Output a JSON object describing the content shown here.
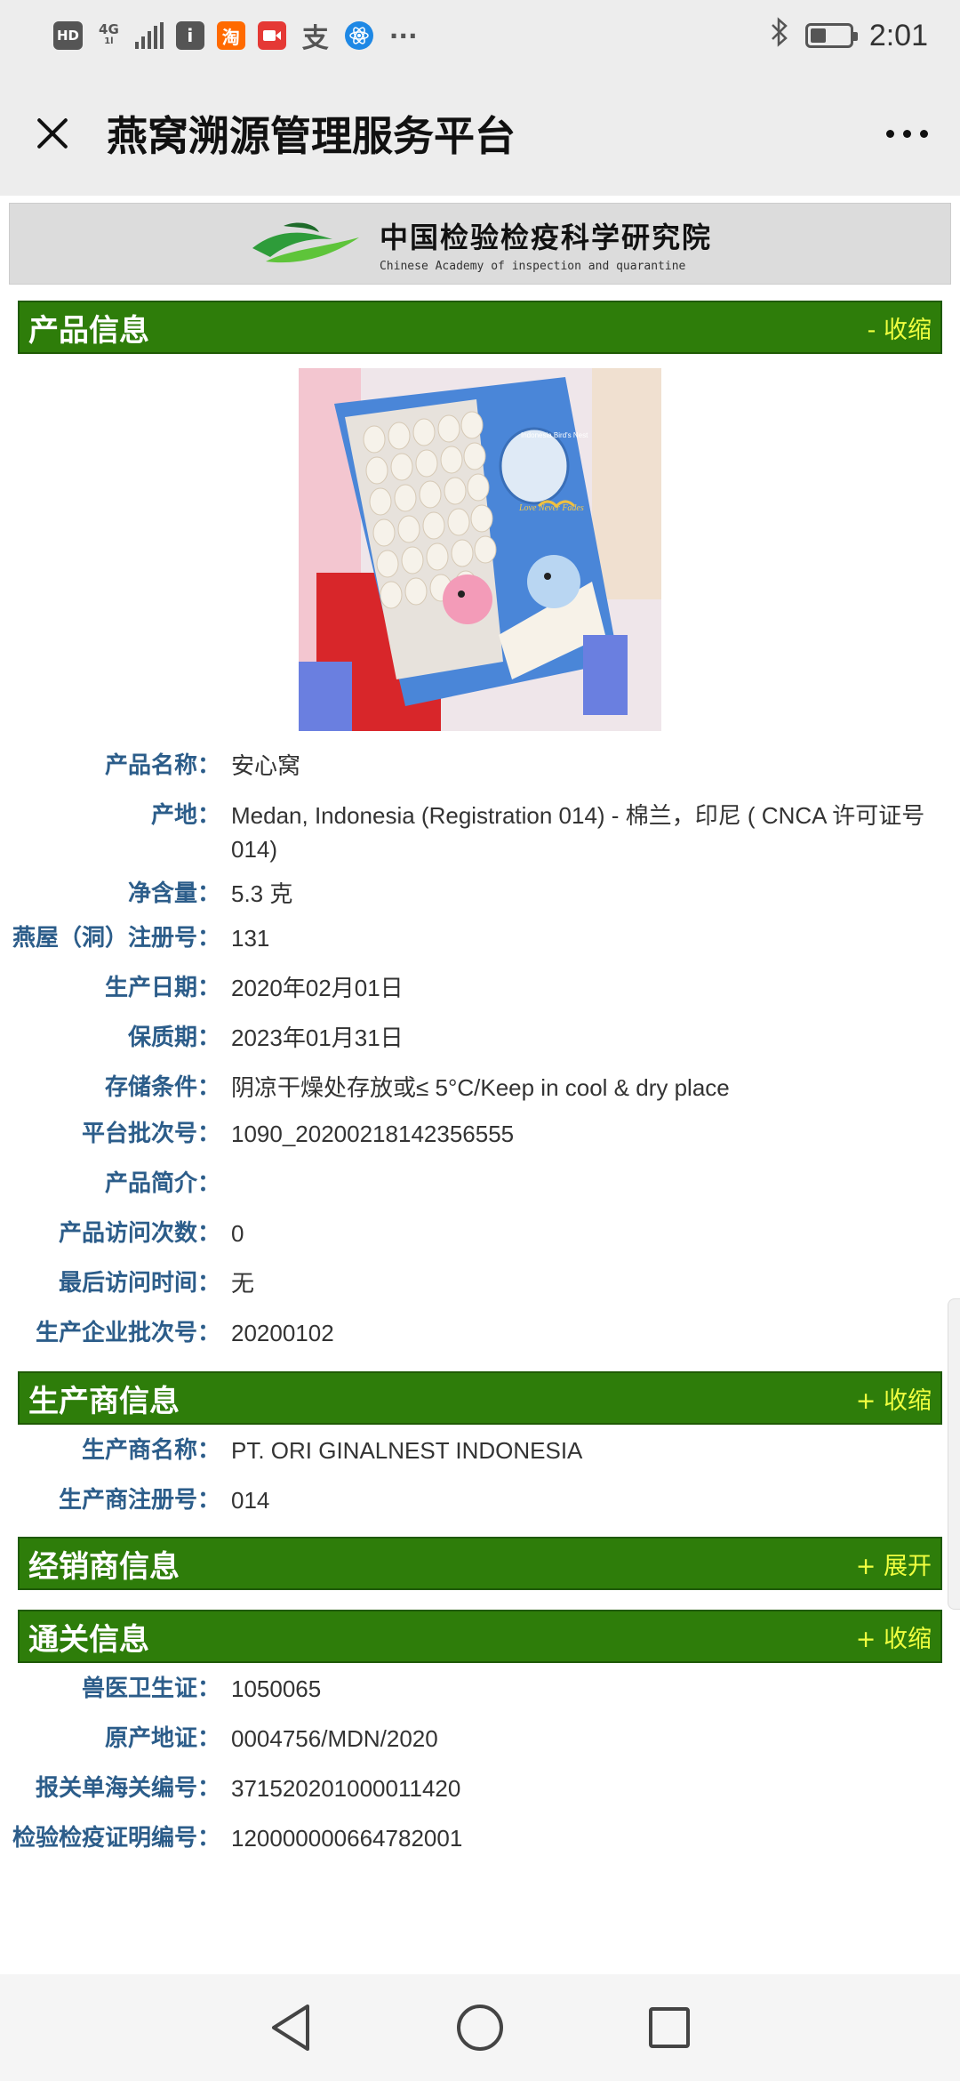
{
  "status_bar": {
    "hd": "HD",
    "network": "4G",
    "network_sub": "1l",
    "app_icons": [
      "info-icon",
      "taobao-icon",
      "video-icon",
      "alipay-icon",
      "react-icon"
    ],
    "taobao_glyph": "淘",
    "alipay_glyph": "支",
    "more": "···",
    "time": "2:01",
    "battery_level": 0.4
  },
  "header": {
    "title": "燕窝溯源管理服务平台"
  },
  "banner": {
    "name_cn": "中国检验检疫科学研究院",
    "name_en": "Chinese Academy of inspection and quarantine"
  },
  "sections": {
    "product": {
      "title": "产品信息",
      "toggle": "- 收缩",
      "fields": [
        {
          "label": "产品名称：",
          "value": "安心窝"
        },
        {
          "label": "产地：",
          "value": "Medan, Indonesia (Registration 014) - 棉兰，印尼 ( CNCA 许可证号 014)"
        },
        {
          "label": "净含量：",
          "value": "5.3 克"
        },
        {
          "label": "燕屋（洞）注册号：",
          "value": "131"
        },
        {
          "label": "生产日期：",
          "value": "2020年02月01日"
        },
        {
          "label": "保质期：",
          "value": "2023年01月31日"
        },
        {
          "label": "存储条件：",
          "value": "阴凉干燥处存放或≤ 5°C/Keep in cool & dry place"
        },
        {
          "label": "平台批次号：",
          "value": "1090_20200218142356555"
        },
        {
          "label": "产品简介：",
          "value": ""
        },
        {
          "label": "产品访问次数：",
          "value": "0"
        },
        {
          "label": "最后访问时间：",
          "value": "无"
        },
        {
          "label": "生产企业批次号：",
          "value": "20200102"
        }
      ]
    },
    "manufacturer": {
      "title": "生产商信息",
      "toggle": "+ 收缩",
      "fields": [
        {
          "label": "生产商名称：",
          "value": "PT. ORI GINALNEST INDONESIA"
        },
        {
          "label": "生产商注册号：",
          "value": "014"
        }
      ]
    },
    "distributor": {
      "title": "经销商信息",
      "toggle": "+ 展开"
    },
    "customs": {
      "title": "通关信息",
      "toggle": "+ 收缩",
      "fields": [
        {
          "label": "兽医卫生证：",
          "value": "1050065"
        },
        {
          "label": "原产地证：",
          "value": "0004756/MDN/2020"
        },
        {
          "label": "报关单海关编号：",
          "value": "371520201000011420"
        },
        {
          "label": "检验检疫证明编号：",
          "value": "120000000664782001"
        }
      ]
    }
  },
  "product_image": {
    "box_label": "Indonesia Bird's Nest",
    "script_label": "Love Never Fades"
  }
}
